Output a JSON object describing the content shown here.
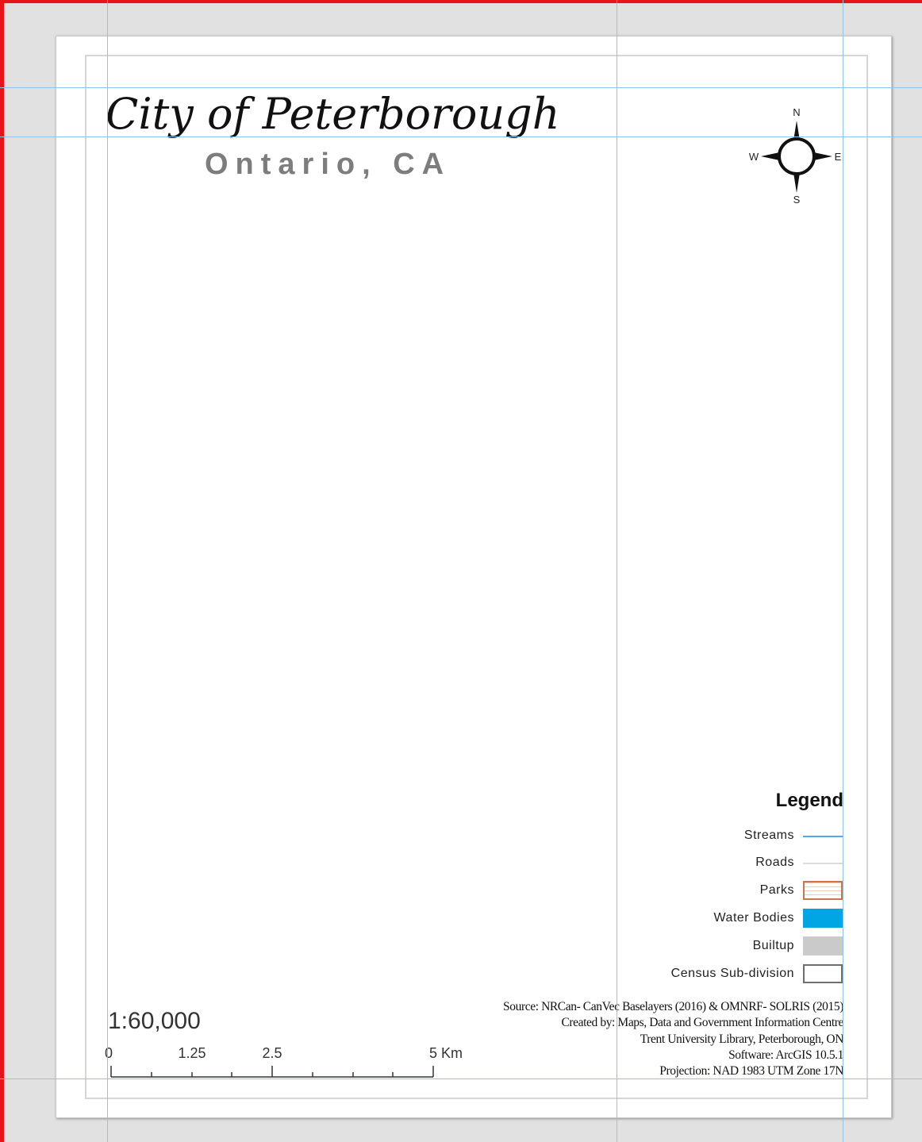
{
  "map": {
    "title": "City of Peterborough",
    "subtitle": "Ontario, CA"
  },
  "north_arrow": {
    "icon": "compass-rose-icon",
    "north": "N",
    "south": "S",
    "east": "E",
    "west": "W"
  },
  "legend": {
    "title": "Legend",
    "items": [
      {
        "label": "Streams",
        "symbol": "line",
        "color": "#5aa7e8"
      },
      {
        "label": "Roads",
        "symbol": "line",
        "color": "#dcdcdc"
      },
      {
        "label": "Parks",
        "symbol": "hatched-box",
        "color": "#c8764a"
      },
      {
        "label": "Water Bodies",
        "symbol": "fill",
        "color": "#00a5e3"
      },
      {
        "label": "Builtup",
        "symbol": "fill",
        "color": "#cacaca"
      },
      {
        "label": "Census Sub-division",
        "symbol": "outline-box",
        "color": "#6e6e6e"
      }
    ]
  },
  "scale": {
    "ratio_text": "1:60,000",
    "labels": [
      "0",
      "1.25",
      "2.5",
      "5 Km"
    ]
  },
  "credits": [
    "Source: NRCan- CanVec Baselayers (2016) & OMNRF- SOLRIS (2015)",
    "Created by: Maps, Data and Government Information Centre",
    "Trent University Library, Peterborough, ON",
    "Software: ArcGIS 10.5.1",
    "Projection: NAD 1983 UTM Zone 17N"
  ],
  "colors": {
    "guide": "#8fc3e8",
    "frame_red": "#e8141a",
    "canvas": "#e1e1e1"
  }
}
